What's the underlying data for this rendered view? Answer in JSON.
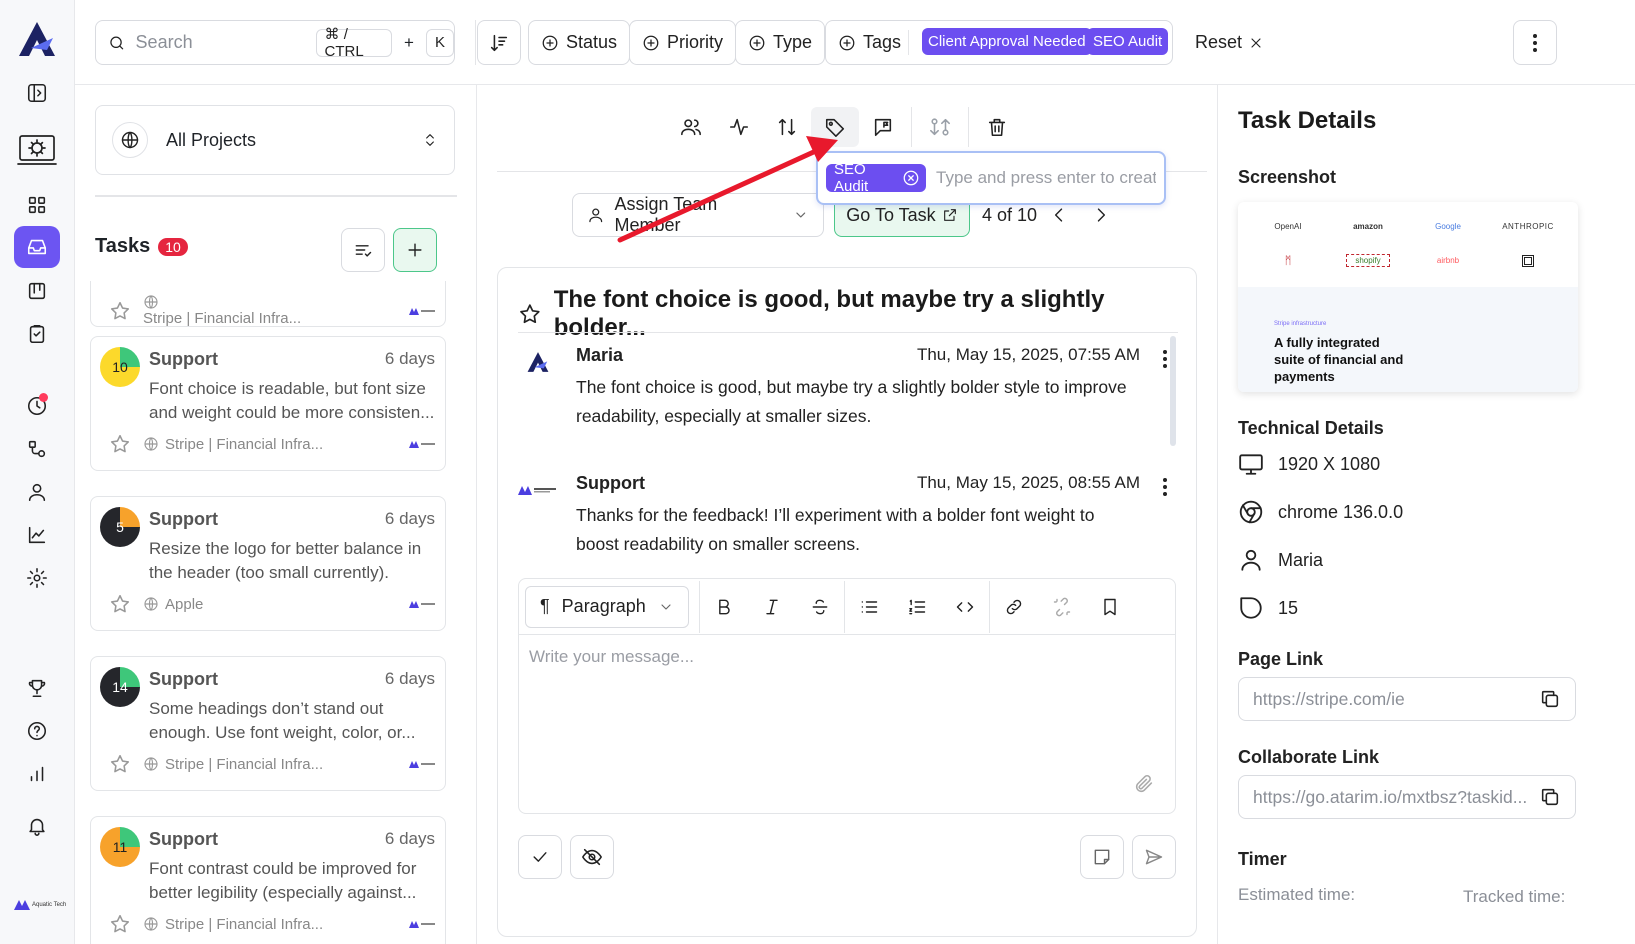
{
  "app": {
    "logo": "atarim-logo"
  },
  "rail": {
    "items": [
      {
        "icon": "sidebar-toggle-icon"
      },
      {
        "icon": "site-settings-icon"
      },
      {
        "icon": "grid-icon"
      },
      {
        "icon": "inbox-icon",
        "active": true
      },
      {
        "icon": "board-icon"
      },
      {
        "icon": "clipboard-icon"
      },
      {
        "icon": "clock-icon",
        "notification": true
      },
      {
        "icon": "workflow-icon"
      },
      {
        "icon": "user-icon"
      },
      {
        "icon": "chart-line-icon"
      },
      {
        "icon": "gear-icon"
      },
      {
        "icon": "trophy-icon"
      },
      {
        "icon": "help-icon"
      },
      {
        "icon": "bar-chart-icon"
      },
      {
        "icon": "bell-icon"
      }
    ],
    "workspace_label": "Aquatic Tech"
  },
  "topbar": {
    "search_placeholder": "Search",
    "shortcut_mod": "⌘ / CTRL",
    "shortcut_plus": "+",
    "shortcut_key": "K",
    "filters": {
      "status": "Status",
      "priority": "Priority",
      "type": "Type",
      "tags": "Tags"
    },
    "chips": [
      "Client Approval Needed",
      "SEO Audit"
    ],
    "reset": "Reset"
  },
  "tasks_panel": {
    "project_selector": "All Projects",
    "title": "Tasks",
    "count": "10",
    "partial_card": {
      "project": "Stripe | Financial Infra..."
    },
    "cards": [
      {
        "number": "10",
        "author": "Support",
        "age": "6 days",
        "text": "Font choice is readable, but font size and weight could be more consisten...",
        "project": "Stripe | Financial Infra...",
        "color": "#fcd92b",
        "accent": "#3ec77a"
      },
      {
        "number": "5",
        "author": "Support",
        "age": "6 days",
        "text": "Resize the logo for better balance in the header (too small currently).",
        "project": "Apple",
        "color": "#25262b",
        "accent": "#f7a22b"
      },
      {
        "number": "14",
        "author": "Support",
        "age": "6 days",
        "text": "Some headings don’t stand out enough. Use font weight, color, or...",
        "project": "Stripe | Financial Infra...",
        "color": "#25262b",
        "accent": "#3ec77a"
      },
      {
        "number": "11",
        "author": "Support",
        "age": "6 days",
        "text": "Font contrast could be improved for better legibility (especially against...",
        "project": "Stripe | Financial Infra...",
        "color": "#f7a22b",
        "accent": "#3ec77a"
      }
    ]
  },
  "main": {
    "tag_popover": {
      "tag": "SEO Audit",
      "placeholder": "Type and press enter to create"
    },
    "assign": "Assign Team Member",
    "go_to_task": "Go To Task",
    "pager": "4 of 10",
    "thread_title": "The font choice is good, but maybe try a slightly bolder...",
    "messages": [
      {
        "author": "Maria",
        "date": "Thu, May 15, 2025, 07:55 AM",
        "body": "The font choice is good, but maybe try a slightly bolder style to improve readability, especially at smaller sizes."
      },
      {
        "author": "Support",
        "date": "Thu, May 15, 2025, 08:55 AM",
        "body": "Thanks for the feedback! I’ll experiment with a bolder font weight to boost readability on smaller screens."
      }
    ],
    "editor": {
      "paragraph": "Paragraph",
      "placeholder": "Write your message..."
    }
  },
  "details": {
    "title": "Task Details",
    "screenshot_label": "Screenshot",
    "screenshot": {
      "logos": [
        "OpenAI",
        "amazon",
        "Google",
        "ANTHROPIC",
        "shopify",
        "airbnb"
      ],
      "small_text": "Stripe infrastructure",
      "headline": "A fully integrated suite of financial and payments"
    },
    "technical_label": "Technical Details",
    "resolution": "1920 X 1080",
    "browser": "chrome 136.0.0",
    "user": "Maria",
    "count": "15",
    "page_link_label": "Page Link",
    "page_link": "https://stripe.com/ie",
    "collab_link_label": "Collaborate Link",
    "collab_link": "https://go.atarim.io/mxtbsz?taskid...",
    "timer_label": "Timer",
    "estimated": "Estimated time:",
    "tracked": "Tracked time:"
  },
  "colors": {
    "accent": "#6c4ef0",
    "rail_active": "#6c55f2",
    "green": "#4cc78a",
    "badge": "#e5253f",
    "arrow": "#e8192c"
  }
}
